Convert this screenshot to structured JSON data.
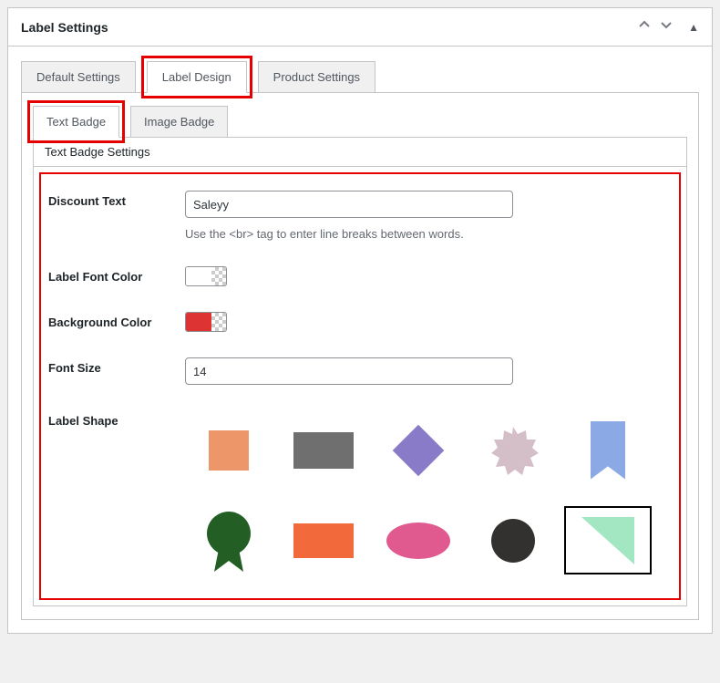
{
  "panel": {
    "title": "Label Settings"
  },
  "tabs": {
    "default": "Default Settings",
    "design": "Label Design",
    "product": "Product Settings"
  },
  "subTabs": {
    "text": "Text Badge",
    "image": "Image Badge"
  },
  "section": {
    "title": "Text Badge Settings"
  },
  "fields": {
    "discountText": {
      "label": "Discount Text",
      "value": "Saleyy",
      "help": "Use the <br> tag to enter line breaks between words."
    },
    "labelFontColor": {
      "label": "Label Font Color",
      "value": "#ffffff"
    },
    "backgroundColor": {
      "label": "Background Color",
      "value": "#dd3333"
    },
    "fontSize": {
      "label": "Font Size",
      "value": "14"
    },
    "labelShape": {
      "label": "Label Shape"
    }
  },
  "shapeColors": {
    "starburst": "#d4bec7",
    "sealGreen": "#235f24",
    "triangle": "#a3e6c2"
  }
}
